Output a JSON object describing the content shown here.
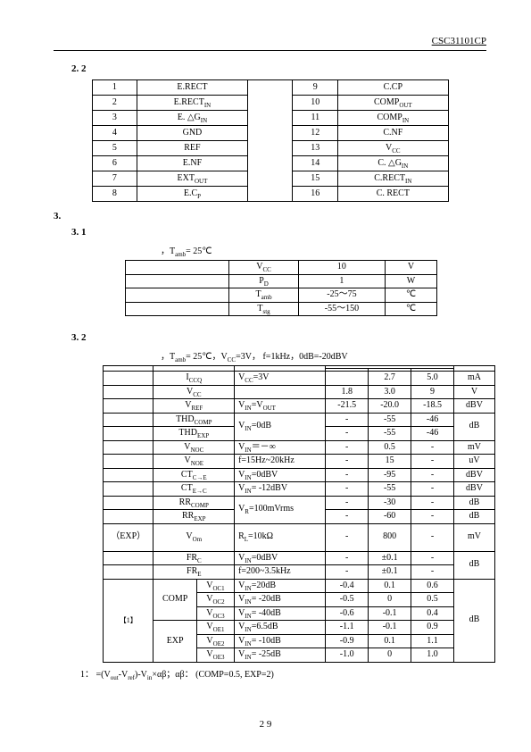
{
  "header": {
    "part": "CSC31101CP"
  },
  "sec22": {
    "title": "2. 2",
    "left": [
      [
        "1",
        "E.RECT"
      ],
      [
        "2",
        "E.RECT_IN"
      ],
      [
        "3",
        "E. △G_IN"
      ],
      [
        "4",
        "GND"
      ],
      [
        "5",
        "REF"
      ],
      [
        "6",
        "E.NF"
      ],
      [
        "7",
        "EXT_OUT"
      ],
      [
        "8",
        "E.C_P"
      ]
    ],
    "right": [
      [
        "9",
        "C.CP"
      ],
      [
        "10",
        "COMP_OUT"
      ],
      [
        "11",
        "COMP_IN"
      ],
      [
        "12",
        "C.NF"
      ],
      [
        "13",
        "V_CC"
      ],
      [
        "14",
        "C. △G_IN"
      ],
      [
        "15",
        "C.RECT_IN"
      ],
      [
        "16",
        "C. RECT"
      ]
    ]
  },
  "sec3": {
    "title": "3."
  },
  "sec31": {
    "title": "3. 1",
    "cond": "，T_amb= 25℃",
    "rows": [
      [
        "V_CC",
        "10",
        "V"
      ],
      [
        "P_D",
        "1",
        "W"
      ],
      [
        "T_amb",
        "-25～75",
        "℃"
      ],
      [
        "T_stg",
        "-55～150",
        "℃"
      ]
    ]
  },
  "sec32": {
    "title": "3. 2",
    "cond": "，T_amb= 25℃，V_CC=3V，  f=1kHz，0dB=-20dBV",
    "rows": [
      {
        "p": "",
        "s": "I_CCQ",
        "c": "V_CC=3V",
        "min": "",
        "typ": "2.7",
        "max": "5.0",
        "u": "mA"
      },
      {
        "p": "",
        "s": "V_CC",
        "c": "",
        "min": "1.8",
        "typ": "3.0",
        "max": "9",
        "u": "V"
      },
      {
        "p": "",
        "s": "V_REF",
        "c": "V_IN=V_OUT",
        "min": "-21.5",
        "typ": "-20.0",
        "max": "-18.5",
        "u": "dBV"
      },
      {
        "p": "",
        "s": "THD_COMP",
        "c": "V_IN=0dB",
        "min": "-",
        "typ": "-55",
        "max": "-46",
        "u": "dB",
        "mergeC": 2,
        "mergeU": 2
      },
      {
        "p": "",
        "s": "THD_EXP",
        "c": "",
        "min": "-",
        "typ": "-55",
        "max": "-46",
        "u": ""
      },
      {
        "p": "",
        "s": "V_NOC",
        "c": "V_IN＝－∞",
        "min": "-",
        "typ": "0.5",
        "max": "-",
        "u": "mV"
      },
      {
        "p": "",
        "s": "V_NOE",
        "c": "f=15Hz~20kHz",
        "min": "-",
        "typ": "15",
        "max": "-",
        "u": "uV"
      },
      {
        "p": "",
        "s": "CT_C→E",
        "c": "V_IN=0dBV",
        "min": "-",
        "typ": "-95",
        "max": "-",
        "u": "dBV"
      },
      {
        "p": "",
        "s": "CT_E→C",
        "c": "V_IN= -12dBV",
        "min": "-",
        "typ": "-55",
        "max": "-",
        "u": "dBV"
      },
      {
        "p": "",
        "s": "RR_COMP",
        "c": "V_R=100mVrms",
        "min": "-",
        "typ": "-30",
        "max": "-",
        "u": "dB",
        "mergeC": 2
      },
      {
        "p": "",
        "s": "RR_EXP",
        "c": "",
        "min": "-",
        "typ": "-60",
        "max": "-",
        "u": "dB"
      },
      {
        "p": "（EXP）",
        "s": "V_Om",
        "c": "R_L=10kΩ",
        "min": "-",
        "typ": "800",
        "max": "-",
        "u": "mV",
        "tall": 1
      },
      {
        "p": "",
        "s": "FR_C",
        "c": "V_IN=0dBV",
        "min": "-",
        "typ": "±0.1",
        "max": "-",
        "u": "dB",
        "mergeU": 2
      },
      {
        "p": "",
        "s": "FR_E",
        "c": "f=200~3.5kHz",
        "min": "-",
        "typ": "±0.1",
        "max": "-",
        "u": ""
      }
    ],
    "block": {
      "plabel": "  【1】",
      "mergeU": "dB",
      "groups": [
        {
          "g": "COMP",
          "rows": [
            {
              "s": "V_OC1",
              "c": "V_IN=20dB",
              "min": "-0.4",
              "typ": "0.1",
              "max": "0.6"
            },
            {
              "s": "V_OC2",
              "c": "V_IN= -20dB",
              "min": "-0.5",
              "typ": "0",
              "max": "0.5"
            },
            {
              "s": "V_OC3",
              "c": "V_IN= -40dB",
              "min": "-0.6",
              "typ": "-0.1",
              "max": "0.4"
            }
          ]
        },
        {
          "g": "EXP",
          "rows": [
            {
              "s": "V_OE1",
              "c": "V_IN=6.5dB",
              "min": "-1.1",
              "typ": "-0.1",
              "max": "0.9"
            },
            {
              "s": "V_OE2",
              "c": "V_IN= -10dB",
              "min": "-0.9",
              "typ": "0.1",
              "max": "1.1"
            },
            {
              "s": "V_OE3",
              "c": "V_IN= -25dB",
              "min": "-1.0",
              "typ": "0",
              "max": "1.0"
            }
          ]
        }
      ]
    },
    "footnote": "1：         =(V_out-V_ref)-V_in×αβ；αβ：  (COMP=0.5, EXP=2)"
  },
  "pagenum": "2      9"
}
